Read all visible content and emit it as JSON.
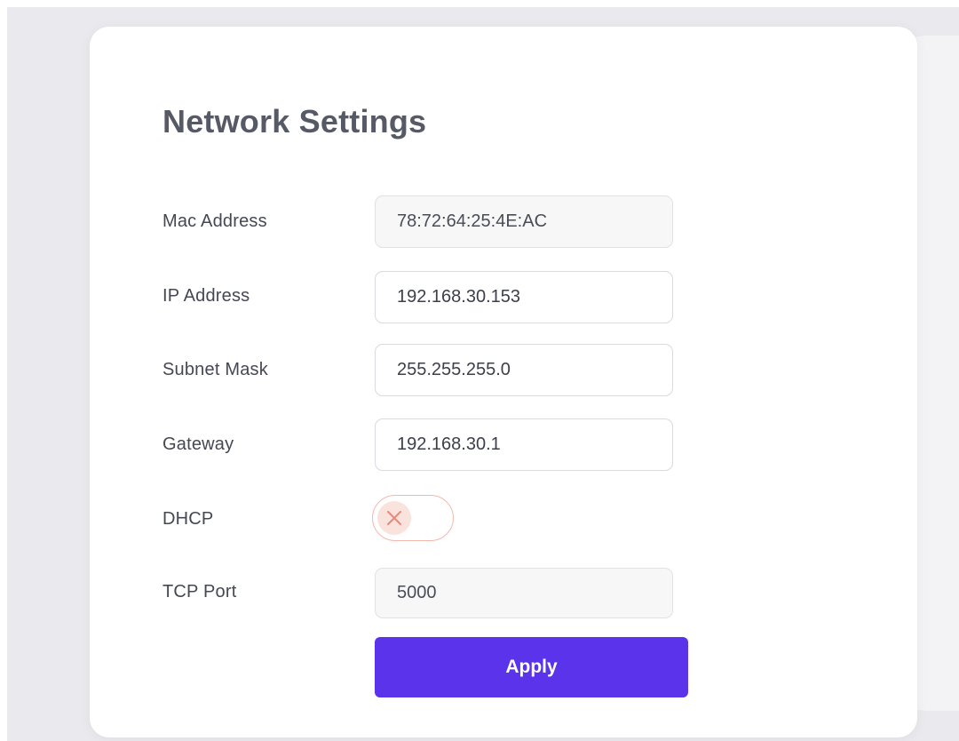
{
  "page": {
    "title": "Network Settings"
  },
  "fields": {
    "mac": {
      "label": "Mac Address",
      "value": "78:72:64:25:4E:AC",
      "readonly": true
    },
    "ip": {
      "label": "IP Address",
      "value": "192.168.30.153",
      "readonly": false
    },
    "subnet": {
      "label": "Subnet Mask",
      "value": "255.255.255.0",
      "readonly": false
    },
    "gateway": {
      "label": "Gateway",
      "value": "192.168.30.1",
      "readonly": false
    },
    "dhcp": {
      "label": "DHCP",
      "enabled": false,
      "icon": "close-icon"
    },
    "tcp_port": {
      "label": "TCP Port",
      "value": "5000",
      "readonly": true
    }
  },
  "actions": {
    "apply_label": "Apply"
  },
  "colors": {
    "accent": "#5b33ea",
    "toggle_off_border": "#f2b8ae",
    "toggle_off_knob": "#fbe3dd",
    "toggle_off_icon": "#e88a7c"
  }
}
